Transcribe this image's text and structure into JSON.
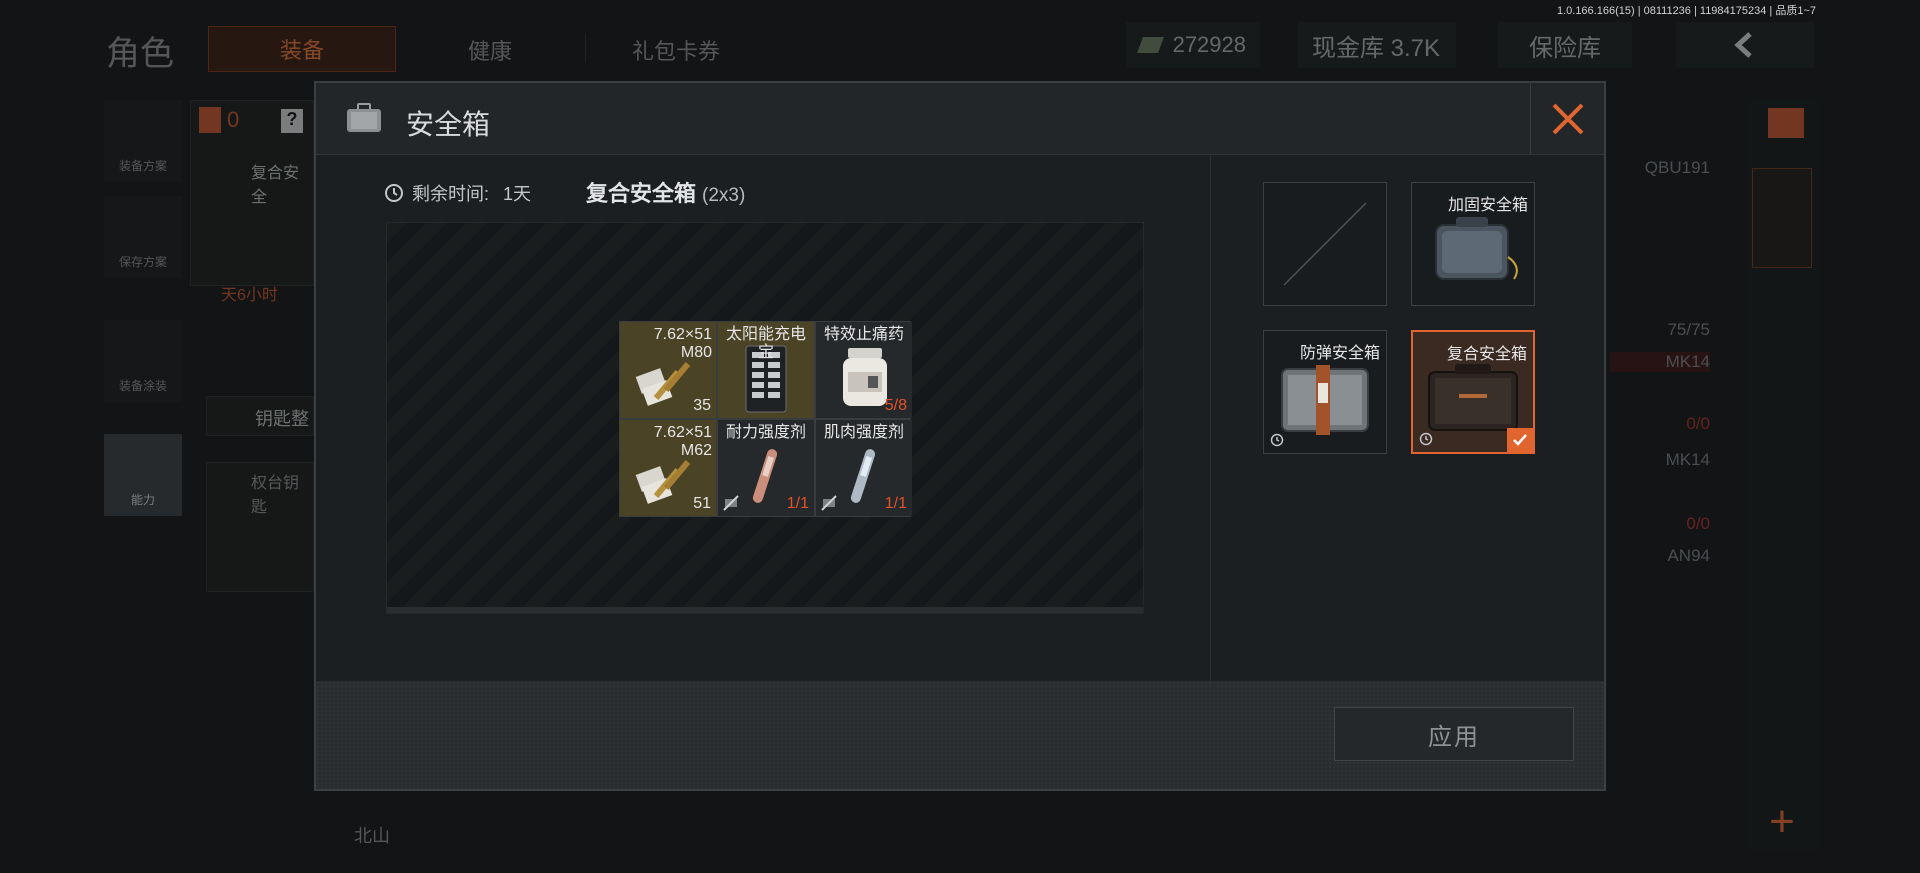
{
  "version_text": "1.0.166.166(15) | 08111236 | 11984175234 | 品质1~7",
  "background": {
    "page_title": "角色",
    "tabs": [
      "装备",
      "健康",
      "礼包卡券"
    ],
    "cash_value": "272928",
    "cash_vault": "现金库 3.7K",
    "insurance": "保险库",
    "side_buttons": [
      "装备方案",
      "保存方案",
      "装备涂装",
      "能力"
    ],
    "red_count": "0",
    "help": "?",
    "peek_case_label": "复合安全",
    "peek_timer": "天6小时",
    "key_section": "钥匙整",
    "key_item": "权台钥匙",
    "map_label": "北山",
    "right_list": [
      "QBU191",
      "75/75",
      "MK14",
      "0/0",
      "MK14",
      "0/0",
      "AN94"
    ],
    "colors": {
      "accent": "#e0652e",
      "bg": "#121415"
    }
  },
  "modal": {
    "title": "安全箱",
    "timer_label": "剩余时间:",
    "timer_value": "1天",
    "case_name": "复合安全箱",
    "case_size": "(2x3)",
    "items": [
      {
        "name": "7.62×51\nM80",
        "count": "35",
        "style": "gold",
        "icon": "ammo-box-icon"
      },
      {
        "name": "太阳能充电宝",
        "count": "",
        "style": "gold",
        "icon": "solar-charger-icon"
      },
      {
        "name": "特效止痛药",
        "count": "5/8",
        "count_color": "red",
        "style": "dark",
        "icon": "pill-bottle-icon"
      },
      {
        "name": "7.62×51\nM62",
        "count": "51",
        "style": "gold",
        "icon": "ammo-box-icon"
      },
      {
        "name": "耐力强度剂",
        "count": "1/1",
        "count_color": "red",
        "style": "dark",
        "icon": "syringe-icon"
      },
      {
        "name": "肌肉强度剂",
        "count": "1/1",
        "count_color": "red",
        "style": "dark",
        "icon": "syringe-icon"
      }
    ],
    "case_options": [
      {
        "label": "",
        "state": "empty"
      },
      {
        "label": "加固安全箱",
        "state": "available"
      },
      {
        "label": "防弹安全箱",
        "state": "timed"
      },
      {
        "label": "复合安全箱",
        "state": "selected"
      }
    ],
    "apply_label": "应用"
  }
}
